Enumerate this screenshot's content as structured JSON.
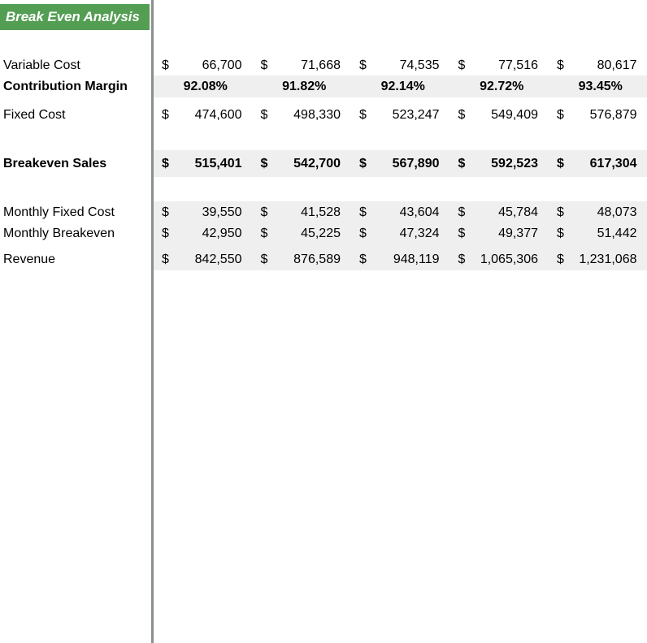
{
  "title": {
    "text": "Break Even Analysis",
    "banner_color": "#539e53",
    "text_color": "#ffffff"
  },
  "styles": {
    "band_color": "#efeff0",
    "divider_color": "#8a8f90",
    "currency_symbol": "$"
  },
  "table": {
    "rows": [
      {
        "label": "Variable Cost",
        "format": "currency",
        "bold": false,
        "shaded": false,
        "values": [
          "66,700",
          "71,668",
          "74,535",
          "77,516",
          "80,617"
        ]
      },
      {
        "label": "Contribution Margin",
        "format": "percent",
        "bold": true,
        "shaded": true,
        "values": [
          "92.08%",
          "91.82%",
          "92.14%",
          "92.72%",
          "93.45%"
        ]
      },
      {
        "label": "Fixed Cost",
        "format": "currency",
        "bold": false,
        "shaded": false,
        "values": [
          "474,600",
          "498,330",
          "523,247",
          "549,409",
          "576,879"
        ]
      },
      {
        "label": "Breakeven Sales",
        "format": "currency",
        "bold": true,
        "shaded": true,
        "values": [
          "515,401",
          "542,700",
          "567,890",
          "592,523",
          "617,304"
        ]
      },
      {
        "label": "Monthly Fixed Cost",
        "format": "currency",
        "bold": false,
        "shaded": true,
        "values": [
          "39,550",
          "41,528",
          "43,604",
          "45,784",
          "48,073"
        ]
      },
      {
        "label": "Monthly Breakeven",
        "format": "currency",
        "bold": false,
        "shaded": true,
        "values": [
          "42,950",
          "45,225",
          "47,324",
          "49,377",
          "51,442"
        ]
      },
      {
        "label": "Revenue",
        "format": "currency",
        "bold": false,
        "shaded": true,
        "values": [
          "842,550",
          "876,589",
          "948,119",
          "1,065,306",
          "1,231,068"
        ]
      }
    ]
  }
}
